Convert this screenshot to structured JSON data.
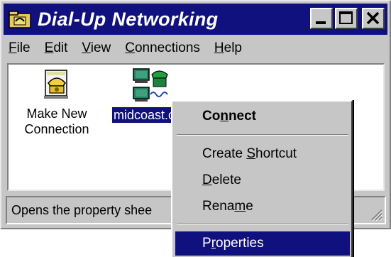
{
  "window": {
    "title": "Dial-Up Networking",
    "buttons": {
      "minimize": "_",
      "maximize": "□",
      "close": "×"
    }
  },
  "menubar": {
    "items": [
      {
        "pre": "",
        "key": "F",
        "post": "ile"
      },
      {
        "pre": "",
        "key": "E",
        "post": "dit"
      },
      {
        "pre": "",
        "key": "V",
        "post": "iew"
      },
      {
        "pre": "",
        "key": "C",
        "post": "onnections"
      },
      {
        "pre": "",
        "key": "H",
        "post": "elp"
      }
    ]
  },
  "client": {
    "items": [
      {
        "label_line1": "Make New",
        "label_line2": "Connection",
        "icon": "make-new-connection-icon"
      },
      {
        "label": "midcoast.c",
        "icon": "dialup-connection-icon",
        "selected": true
      }
    ]
  },
  "statusbar": {
    "text": "Opens the property shee"
  },
  "context_menu": {
    "connect": {
      "pre": "Co",
      "key": "n",
      "post": "nect"
    },
    "create_shortcut": {
      "pre": "Create ",
      "key": "S",
      "post": "hortcut"
    },
    "delete": {
      "pre": "",
      "key": "D",
      "post": "elete"
    },
    "rename": {
      "pre": "Rena",
      "key": "m",
      "post": "e"
    },
    "properties": {
      "pre": "P",
      "key": "r",
      "post": "operties"
    }
  },
  "colors": {
    "titlebar": "#10107e",
    "face": "#c6c6c6",
    "highlight": "#10107e"
  }
}
